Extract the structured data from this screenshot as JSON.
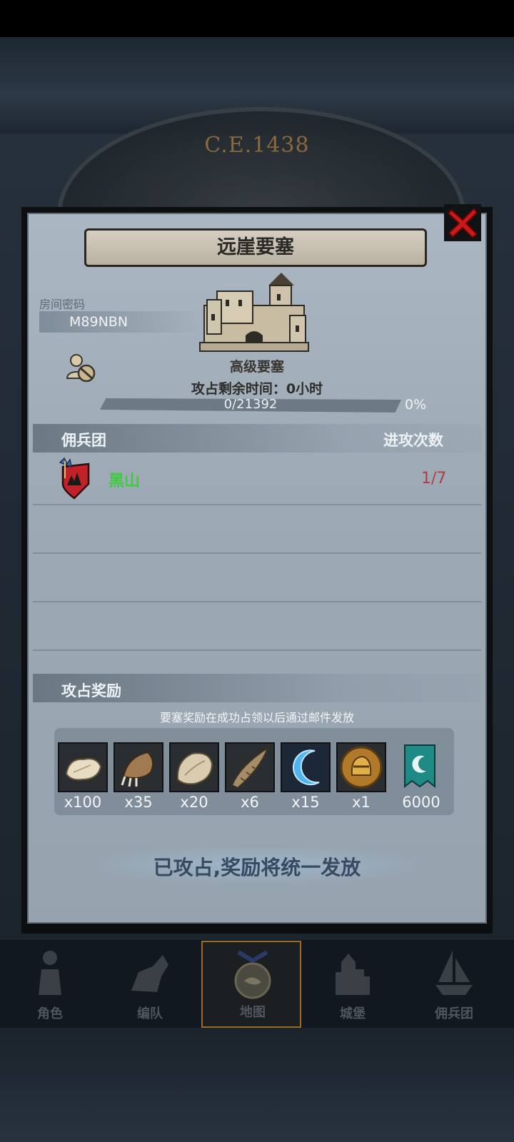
{
  "background": {
    "era_text": "C.E.1438"
  },
  "dialog": {
    "title": "远崖要塞",
    "room": {
      "label": "房间密码",
      "code": "M89NBN"
    },
    "fort": {
      "type": "高级要塞",
      "remaining_time": "攻占剩余时间：0小时",
      "progress_text": "0/21392",
      "progress_percent": "0%",
      "progress_fraction": 0
    },
    "mercenary_section": {
      "header_left": "佣兵团",
      "header_right": "进攻次数",
      "rows": [
        {
          "name": "黑山",
          "attacks": "1/7"
        }
      ]
    },
    "reward_section": {
      "header": "攻占奖励",
      "note": "要塞奖励在成功占领以后通过邮件发放",
      "items": [
        {
          "icon": "fur-pelt-icon",
          "qty": "x100"
        },
        {
          "icon": "claw-icon",
          "qty": "x35"
        },
        {
          "icon": "hide-icon",
          "qty": "x20"
        },
        {
          "icon": "horn-icon",
          "qty": "x6"
        },
        {
          "icon": "crescent-icon",
          "qty": "x15"
        },
        {
          "icon": "helmet-medal-icon",
          "qty": "x1"
        },
        {
          "icon": "banner-icon",
          "qty": "6000"
        }
      ]
    },
    "status_button": "已攻占,奖励将统一发放"
  },
  "nav": {
    "items": [
      {
        "label": "角色",
        "icon": "knight-icon"
      },
      {
        "label": "编队",
        "icon": "cavalry-icon"
      },
      {
        "label": "地图",
        "icon": "map-icon",
        "active": true
      },
      {
        "label": "城堡",
        "icon": "castle-icon"
      },
      {
        "label": "佣兵团",
        "icon": "ship-icon"
      }
    ]
  },
  "colors": {
    "merc_name": "#3ecb3e",
    "attack_count": "#b23b44",
    "nav_active_border": "#9a6a2a"
  }
}
